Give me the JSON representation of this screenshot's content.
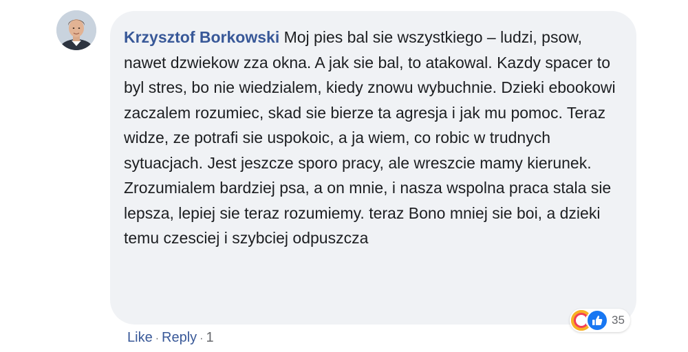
{
  "comment": {
    "author": "Krzysztof Borkowski",
    "text": " Moj pies bal sie wszystkiego – ludzi, psow, nawet dzwiekow zza okna. A jak sie bal, to atakowal. Kazdy spacer to byl stres, bo nie wiedzialem, kiedy znowu wybuchnie. Dzieki ebookowi zaczalem rozumiec, skad sie bierze ta agresja i jak mu pomoc. Teraz widze, ze potrafi sie uspokoic, a ja wiem, co robic w trudnych sytuacjach. Jest jeszcze sporo pracy, ale wreszcie mamy kierunek. Zrozumialem bardziej psa, a on mnie, i nasza wspolna praca stala sie lepsza, lepiej sie teraz rozumiemy. teraz Bono mniej sie boi, a dzieki temu czesciej i szybciej odpuszcza"
  },
  "reactions": {
    "count": "35",
    "icons": [
      "care-icon",
      "like-icon"
    ],
    "care_color": "#f7b125",
    "like_color": "#1877f2"
  },
  "actions": {
    "like_label": "Like",
    "reply_label": "Reply",
    "separator": "·",
    "time": "1"
  },
  "colors": {
    "author": "#385898",
    "bubble": "#f0f2f5",
    "text": "#1c1e21"
  }
}
